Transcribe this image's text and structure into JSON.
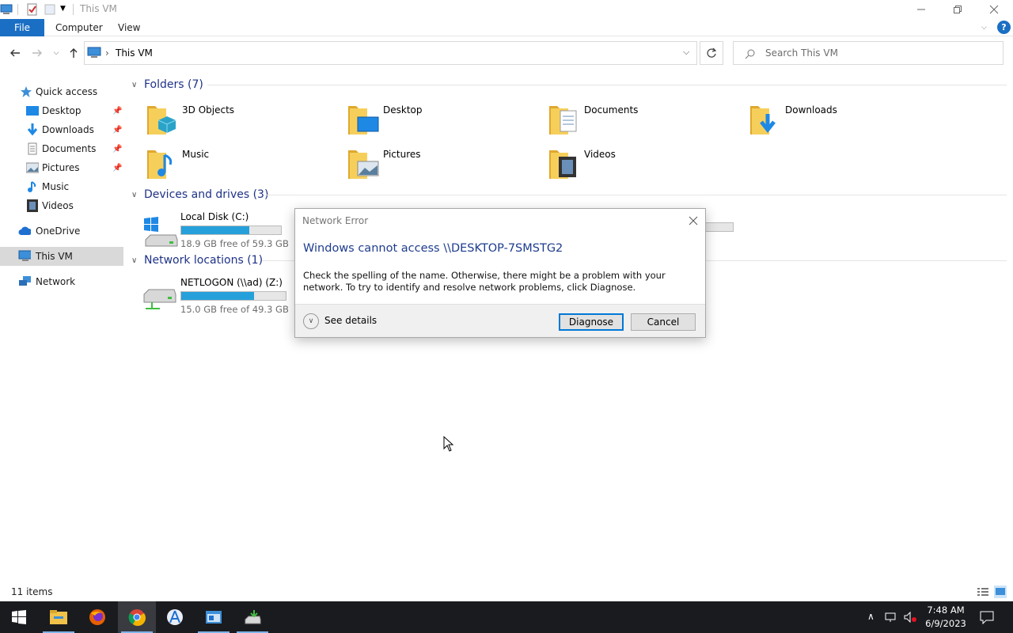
{
  "window": {
    "title": "This VM"
  },
  "ribbon": {
    "tabs": [
      "File",
      "Computer",
      "View"
    ]
  },
  "address": {
    "location": "This VM"
  },
  "search": {
    "placeholder": "Search This VM"
  },
  "sidebar": {
    "items": [
      {
        "label": "Quick access"
      },
      {
        "label": "Desktop"
      },
      {
        "label": "Downloads"
      },
      {
        "label": "Documents"
      },
      {
        "label": "Pictures"
      },
      {
        "label": "Music"
      },
      {
        "label": "Videos"
      },
      {
        "label": "OneDrive"
      },
      {
        "label": "This VM"
      },
      {
        "label": "Network"
      }
    ]
  },
  "folders": {
    "header": "Folders (7)",
    "items": [
      "3D Objects",
      "Desktop",
      "Documents",
      "Downloads",
      "Music",
      "Pictures",
      "Videos"
    ]
  },
  "drives": {
    "header": "Devices and drives (3)",
    "items": [
      {
        "name": "Local Disk (C:)",
        "free": "18.9 GB free of 59.3 GB",
        "used_fraction": 0.68
      }
    ]
  },
  "network_locations": {
    "header": "Network locations (1)",
    "items": [
      {
        "name": "NETLOGON (\\\\ad) (Z:)",
        "free": "15.0 GB free of 49.3 GB",
        "used_fraction": 0.7
      }
    ]
  },
  "status": {
    "items": "11 items"
  },
  "dialog": {
    "title": "Network Error",
    "heading": "Windows cannot access \\\\DESKTOP-7SMSTG2",
    "body": "Check the spelling of the name. Otherwise, there might be a problem with your network. To try to identify and resolve network problems, click Diagnose.",
    "details": "See details",
    "diagnose": "Diagnose",
    "cancel": "Cancel"
  },
  "taskbar": {
    "time": "7:48 AM",
    "date": "6/9/2023"
  },
  "colors": {
    "accent": "#1a6fc4",
    "drive_bar": "#26a0da",
    "folder": "#f0c24a"
  }
}
